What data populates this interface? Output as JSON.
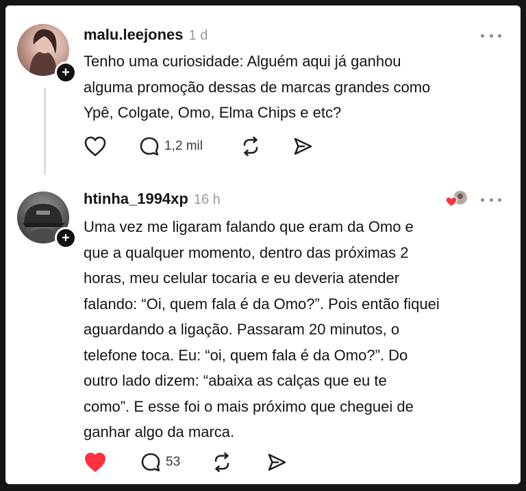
{
  "posts": [
    {
      "username": "malu.leejones",
      "timestamp": "1 d",
      "text": "Tenho uma curiosidade: Alguém aqui já ganhou\nalguma promoção dessas de marcas grandes como\nYpê, Colgate, Omo, Elma Chips e etc?",
      "liked": false,
      "reply_count": "1,2 mil",
      "icons": [
        "avatar",
        "plus-icon",
        "more-icon",
        "heart-outline-icon",
        "comment-icon",
        "repost-icon",
        "send-icon"
      ]
    },
    {
      "username": "htinha_1994xp",
      "timestamp": "16 h",
      "text": "Uma vez me ligaram falando que eram da Omo e\nque a qualquer momento, dentro das próximas 2\nhoras, meu celular tocaria e eu deveria atender\nfalando: “Oi, quem fala é da Omo?”. Pois então fiquei\naguardando a ligação. Passaram 20 minutos, o\ntelefone toca. Eu: “oi, quem fala é da Omo?”. Do\noutro lado dizem: “abaixa as calças que eu te\ncomo”. E esse foi o mais próximo que cheguei de\nganhar algo da marca.",
      "liked": true,
      "reply_count": "53",
      "icons": [
        "avatar",
        "plus-icon",
        "liked-by-avatar",
        "more-icon",
        "heart-filled-icon",
        "comment-icon",
        "repost-icon",
        "send-icon"
      ]
    }
  ],
  "colors": {
    "background": "#151515",
    "card": "#ffffff",
    "text": "#141414",
    "muted": "#9a9a9a",
    "like_red": "#ff3040"
  }
}
